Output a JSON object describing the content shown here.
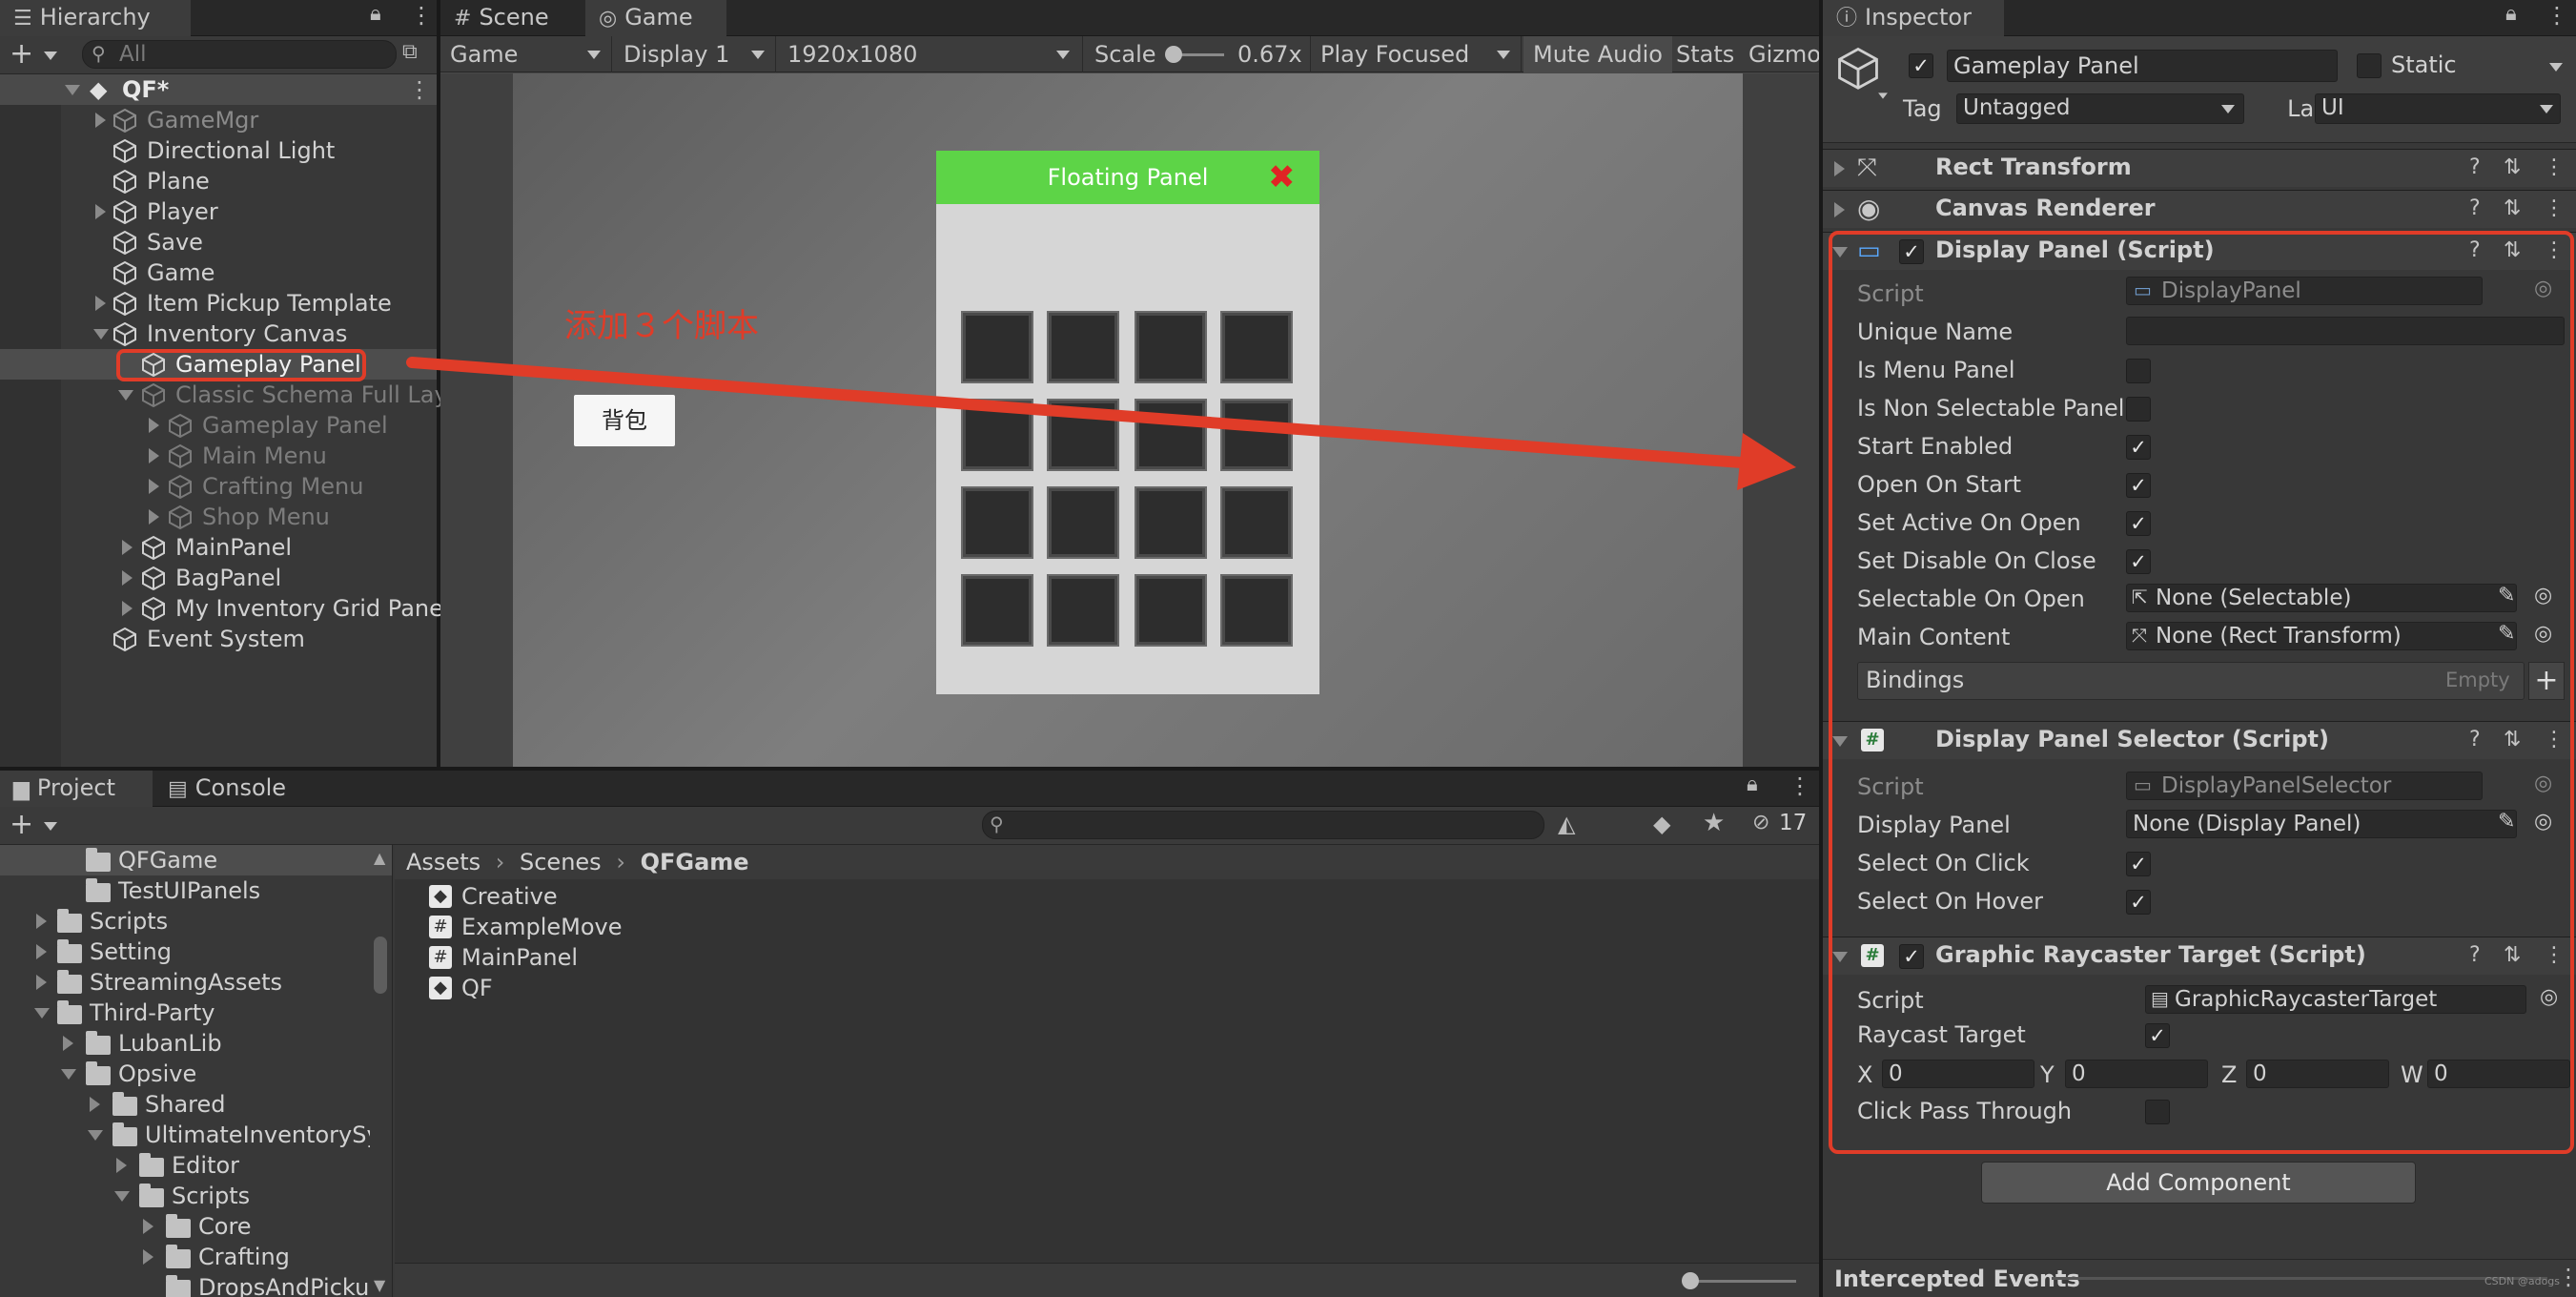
{
  "hierarchy": {
    "tab": "Hierarchy",
    "search_placeholder": "All",
    "items": [
      {
        "label": "QF*"
      },
      {
        "label": "GameMgr"
      },
      {
        "label": "Directional Light"
      },
      {
        "label": "Plane"
      },
      {
        "label": "Player"
      },
      {
        "label": "Save"
      },
      {
        "label": "Game"
      },
      {
        "label": "Item Pickup Template"
      },
      {
        "label": "Inventory Canvas"
      },
      {
        "label": "Gameplay Panel"
      },
      {
        "label": "Classic Schema Full Lay"
      },
      {
        "label": "Gameplay Panel"
      },
      {
        "label": "Main Menu"
      },
      {
        "label": "Crafting Menu"
      },
      {
        "label": "Shop Menu"
      },
      {
        "label": "MainPanel"
      },
      {
        "label": "BagPanel"
      },
      {
        "label": "My Inventory Grid Panel"
      },
      {
        "label": "Event System"
      }
    ]
  },
  "viewport": {
    "tab_scene": "Scene",
    "tab_game": "Game",
    "mode": "Game",
    "display": "Display 1",
    "resolution": "1920x1080",
    "scale_label": "Scale",
    "scale_value": "0.67x",
    "play_mode": "Play Focused",
    "mute": "Mute Audio",
    "stats": "Stats",
    "gizmos": "Gizmos",
    "annotation": "添加３个脚本",
    "bag_button": "背包",
    "floating_panel_title": "Floating Panel",
    "close_glyph": "✖",
    "accent": "#5dd447",
    "annotation_color": "#e03c28"
  },
  "project": {
    "tab_project": "Project",
    "tab_console": "Console",
    "hidden_count": "17",
    "breadcrumb": [
      "Assets",
      "Scenes",
      "QFGame"
    ],
    "tree": [
      {
        "label": "QFGame"
      },
      {
        "label": "TestUIPanels"
      },
      {
        "label": "Scripts"
      },
      {
        "label": "Setting"
      },
      {
        "label": "StreamingAssets"
      },
      {
        "label": "Third-Party"
      },
      {
        "label": "LubanLib"
      },
      {
        "label": "Opsive"
      },
      {
        "label": "Shared"
      },
      {
        "label": "UltimateInventorySys"
      },
      {
        "label": "Editor"
      },
      {
        "label": "Scripts"
      },
      {
        "label": "Core"
      },
      {
        "label": "Crafting"
      },
      {
        "label": "DropsAndPicku"
      }
    ],
    "files": [
      {
        "label": "Creative",
        "icon": "unity-scene-icon"
      },
      {
        "label": "ExampleMove",
        "icon": "csharp-script-icon"
      },
      {
        "label": "MainPanel",
        "icon": "csharp-script-icon"
      },
      {
        "label": "QF",
        "icon": "unity-scene-icon"
      }
    ]
  },
  "inspector": {
    "tab": "Inspector",
    "object_name": "Gameplay Panel",
    "static_label": "Static",
    "tag_label": "Tag",
    "tag_value": "Untagged",
    "layer_label": "Layer",
    "layer_value": "UI",
    "rect_transform": "Rect Transform",
    "canvas_renderer": "Canvas Renderer",
    "display_panel": {
      "title": "Display Panel (Script)",
      "script_label": "Script",
      "script_value": "DisplayPanel",
      "unique_name": "Unique Name",
      "is_menu_panel": "Is Menu Panel",
      "is_non_selectable": "Is Non Selectable Panel",
      "start_enabled": "Start Enabled",
      "open_on_start": "Open On Start",
      "set_active_on_open": "Set Active On Open",
      "set_disable_on_close": "Set Disable On Close",
      "selectable_on_open": "Selectable On Open",
      "selectable_on_open_value": "None (Selectable)",
      "main_content": "Main Content",
      "main_content_value": "None (Rect Transform)",
      "bindings": "Bindings",
      "bindings_state": "Empty"
    },
    "selector": {
      "title": "Display Panel Selector (Script)",
      "script_label": "Script",
      "script_value": "DisplayPanelSelector",
      "display_panel": "Display Panel",
      "display_panel_value": "None (Display Panel)",
      "select_on_click": "Select On Click",
      "select_on_hover": "Select On Hover"
    },
    "raycaster": {
      "title": "Graphic Raycaster Target (Script)",
      "script_label": "Script",
      "script_value": "GraphicRaycasterTarget",
      "raycast_target": "Raycast Target",
      "x_label": "X",
      "x": "0",
      "y_label": "Y",
      "y": "0",
      "z_label": "Z",
      "z": "0",
      "w_label": "W",
      "w": "0",
      "click_pass_through": "Click Pass Through"
    },
    "add_component": "Add Component",
    "intercepted_events": "Intercepted Events",
    "watermark": "CSDN @adogs"
  }
}
